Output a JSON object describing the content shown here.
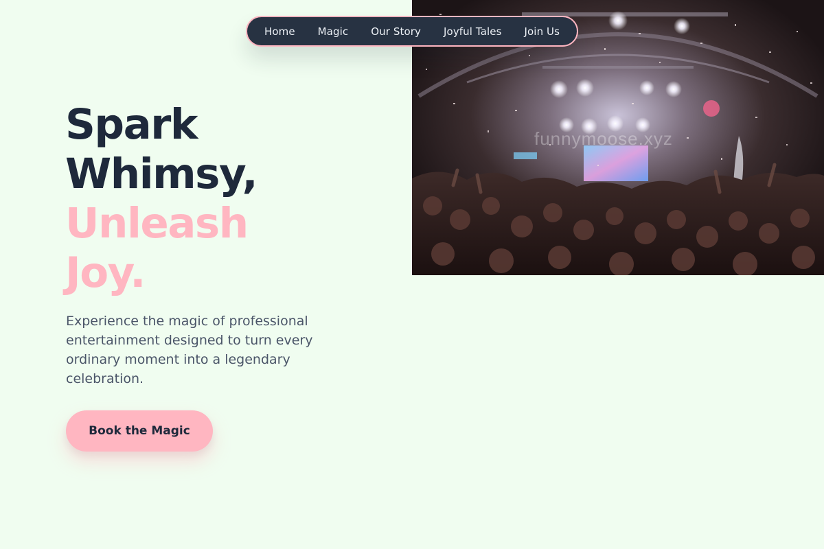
{
  "nav": {
    "items": [
      {
        "label": "Home"
      },
      {
        "label": "Magic"
      },
      {
        "label": "Our Story"
      },
      {
        "label": "Joyful Tales"
      },
      {
        "label": "Join Us"
      }
    ]
  },
  "hero": {
    "headline": {
      "line1": "Spark",
      "line2": "Whimsy,",
      "line3": "Unleash",
      "line4": "Joy."
    },
    "description": "Experience the magic of professional entertainment designed to turn every ordinary moment into a legendary celebration.",
    "cta_label": "Book the Magic",
    "image": {
      "subject": "concert-crowd-confetti-photo",
      "watermark": "funnymoose.xyz"
    }
  },
  "colors": {
    "background": "#f0fdf0",
    "navy": "#1e293b",
    "accent_pink": "#ffb6c1",
    "body_text": "#4a5568"
  }
}
